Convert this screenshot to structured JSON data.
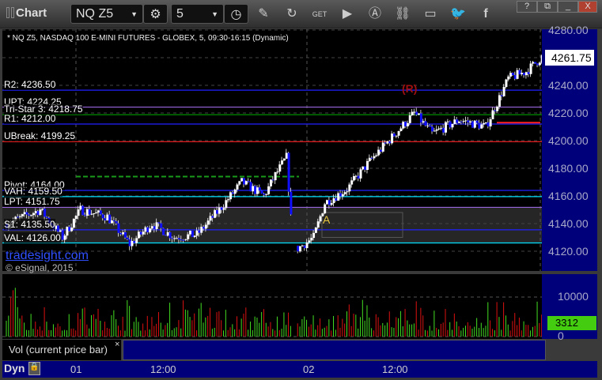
{
  "window": {
    "title": "Chart",
    "help": "?",
    "minimize": "_",
    "maximize": "□",
    "close": "X"
  },
  "toolbar": {
    "symbol": "NQ Z5",
    "interval": "5"
  },
  "chart": {
    "header": "* NQ Z5, NASDAQ 100 E-MINI FUTURES - GLOBEX, 5, 09:30-16:15 (Dynamic)",
    "levels": [
      {
        "label": "R2: 4236.50",
        "price": 4236.5,
        "color": "#2020ff"
      },
      {
        "label": "UPT: 4224.25",
        "price": 4224.25,
        "color": "#9966dd"
      },
      {
        "label": "Tri-Star 3: 4218.75",
        "price": 4218.75,
        "color": "#00a000"
      },
      {
        "label": "R1: 4212.00",
        "price": 4212,
        "color": "#2020ff"
      },
      {
        "label": "UBreak: 4199.25",
        "price": 4199.25,
        "color": "#ff2020"
      },
      {
        "label": "Pivot: 4164.00",
        "price": 4164,
        "color": "#2020ff"
      },
      {
        "label": "VAH: 4159.50",
        "price": 4159.5,
        "color": "#00e0ff"
      },
      {
        "label": "LPT: 4151.75",
        "price": 4151.75,
        "color": "#9966dd"
      },
      {
        "label": "S1: 4135.50",
        "price": 4135.5,
        "color": "#2020ff"
      },
      {
        "label": "VAL: 4126.00",
        "price": 4126,
        "color": "#00e0ff"
      }
    ],
    "price_axis": [
      "4280.00",
      "4260.00",
      "4240.00",
      "4220.00",
      "4200.00",
      "4180.00",
      "4160.00",
      "4140.00",
      "4120.00"
    ],
    "current_price": "4261.75",
    "brand": "tradesight.com",
    "copyright": "© eSignal, 2015",
    "marker_a": "A",
    "annotation_r": "(R)",
    "price_keypoints": [
      [
        0,
        4140
      ],
      [
        15,
        4150
      ],
      [
        25,
        4130
      ],
      [
        33,
        4150
      ],
      [
        45,
        4145
      ],
      [
        55,
        4125
      ],
      [
        65,
        4140
      ],
      [
        75,
        4130
      ],
      [
        85,
        4132
      ],
      [
        95,
        4150
      ],
      [
        105,
        4170
      ],
      [
        115,
        4160
      ],
      [
        120,
        4175
      ],
      [
        125,
        4188
      ],
      [
        128,
        4122
      ],
      [
        135,
        4130
      ],
      [
        140,
        4155
      ],
      [
        150,
        4165
      ],
      [
        160,
        4185
      ],
      [
        180,
        4220
      ],
      [
        188,
        4205
      ],
      [
        200,
        4215
      ],
      [
        212,
        4210
      ],
      [
        222,
        4245
      ],
      [
        230,
        4250
      ],
      [
        238,
        4262
      ]
    ]
  },
  "volume": {
    "label": "Vol (current price bar)",
    "close": "×",
    "axis": [
      "10000",
      "0"
    ],
    "current": "3312"
  },
  "time_axis": {
    "mode": "Dyn",
    "labels": [
      "01",
      "12:00",
      "02",
      "12:00"
    ]
  },
  "colors": {
    "up": "#ffffff",
    "down": "#1010ff",
    "vol_up": "#44dd22",
    "vol_down": "#dd1111",
    "axis_bg": "#00007a"
  }
}
